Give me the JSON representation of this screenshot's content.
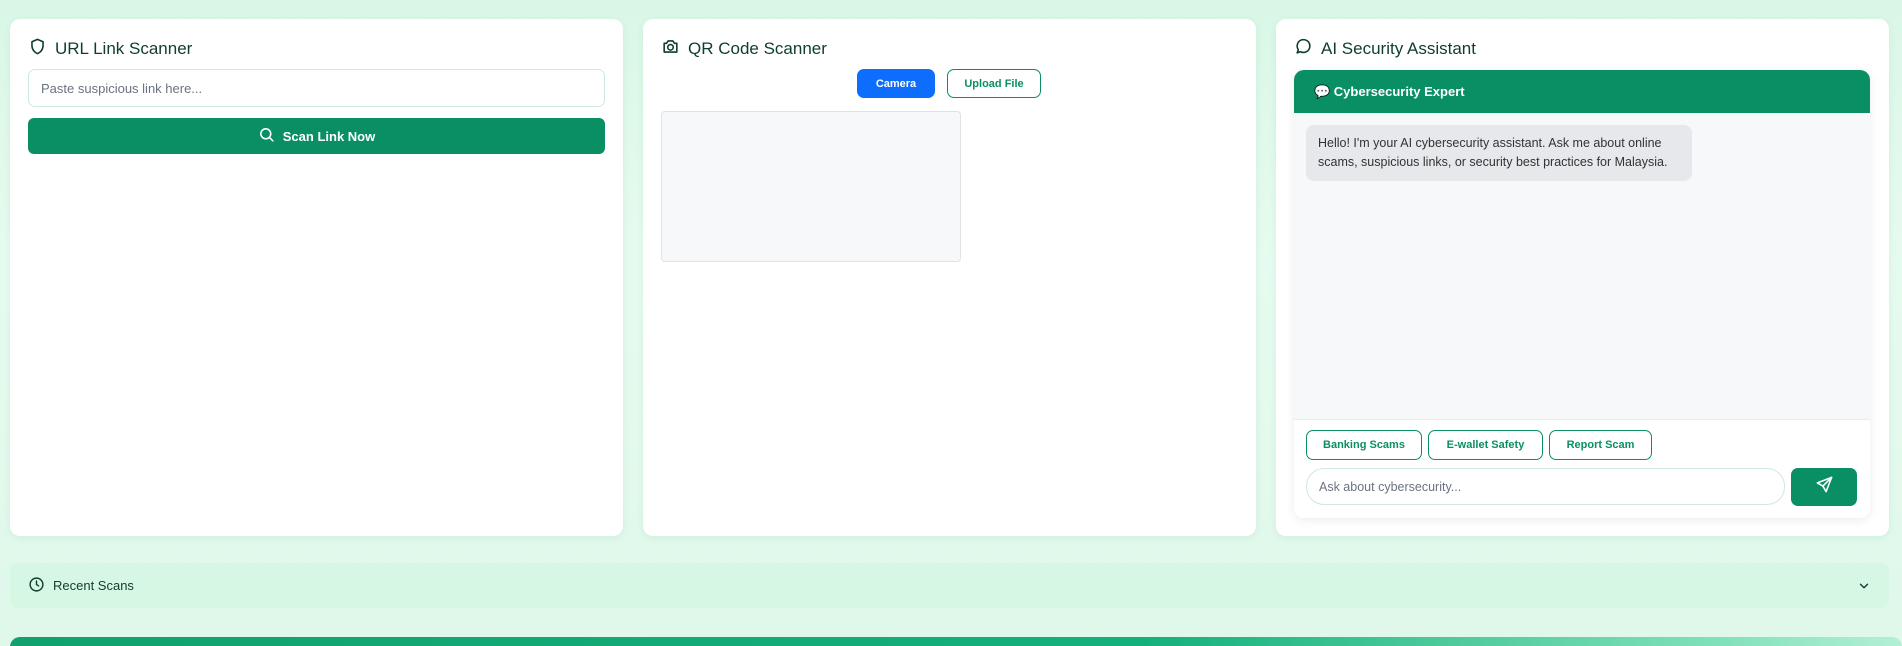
{
  "url_scanner": {
    "title": "URL Link Scanner",
    "title_icon": "shield-icon",
    "input_placeholder": "Paste suspicious link here...",
    "scan_button_label": "Scan Link Now",
    "scan_button_icon": "search-icon"
  },
  "qr_scanner": {
    "title": "QR Code Scanner",
    "title_icon": "camera-icon",
    "camera_button_label": "Camera",
    "upload_button_label": "Upload File"
  },
  "ai_assistant": {
    "title": "AI Security Assistant",
    "title_icon": "chat-bubble-icon",
    "header_label": "💬 Cybersecurity Expert",
    "greeting_message": "Hello! I'm your AI cybersecurity assistant. Ask me about online scams, suspicious links, or security best practices for Malaysia.",
    "quick_chips": [
      {
        "label": "Banking Scams"
      },
      {
        "label": "E-wallet Safety"
      },
      {
        "label": "Report Scam"
      }
    ],
    "input_placeholder": "Ask about cybersecurity...",
    "send_icon": "send-icon"
  },
  "recent_scans": {
    "label": "Recent Scans",
    "icon": "clock-icon",
    "toggle_icon": "chevron-down-icon"
  },
  "colors": {
    "primary_green": "#0a8f64",
    "camera_blue": "#0d6efd",
    "background_mint": "#dff8ea"
  }
}
